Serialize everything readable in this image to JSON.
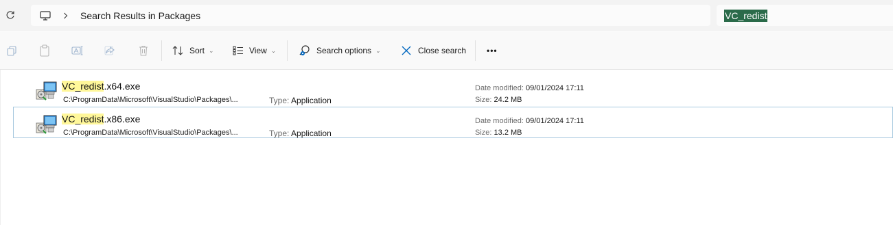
{
  "address_bar": {
    "breadcrumb": "Search Results in Packages",
    "search_query": "VC_redist"
  },
  "toolbar": {
    "sort_label": "Sort",
    "view_label": "View",
    "search_options_label": "Search options",
    "close_search_label": "Close search",
    "more_label": "•••"
  },
  "results": [
    {
      "name_highlight": "VC_redist",
      "name_rest": ".x64.exe",
      "path": "C:\\ProgramData\\Microsoft\\VisualStudio\\Packages\\...",
      "type_label": "Type:",
      "type_value": "Application",
      "modified_label": "Date modified:",
      "modified_value": "09/01/2024 17:11",
      "size_label": "Size:",
      "size_value": "24.2 MB"
    },
    {
      "name_highlight": "VC_redist",
      "name_rest": ".x86.exe",
      "path": "C:\\ProgramData\\Microsoft\\VisualStudio\\Packages\\...",
      "type_label": "Type:",
      "type_value": "Application",
      "modified_label": "Date modified:",
      "modified_value": "09/01/2024 17:11",
      "size_label": "Size:",
      "size_value": "13.2 MB"
    }
  ],
  "colors": {
    "accent": "#0067c0",
    "search_selection": "#2b6b4a",
    "match_highlight": "#fff79a",
    "selection_border": "#a6c8de"
  }
}
